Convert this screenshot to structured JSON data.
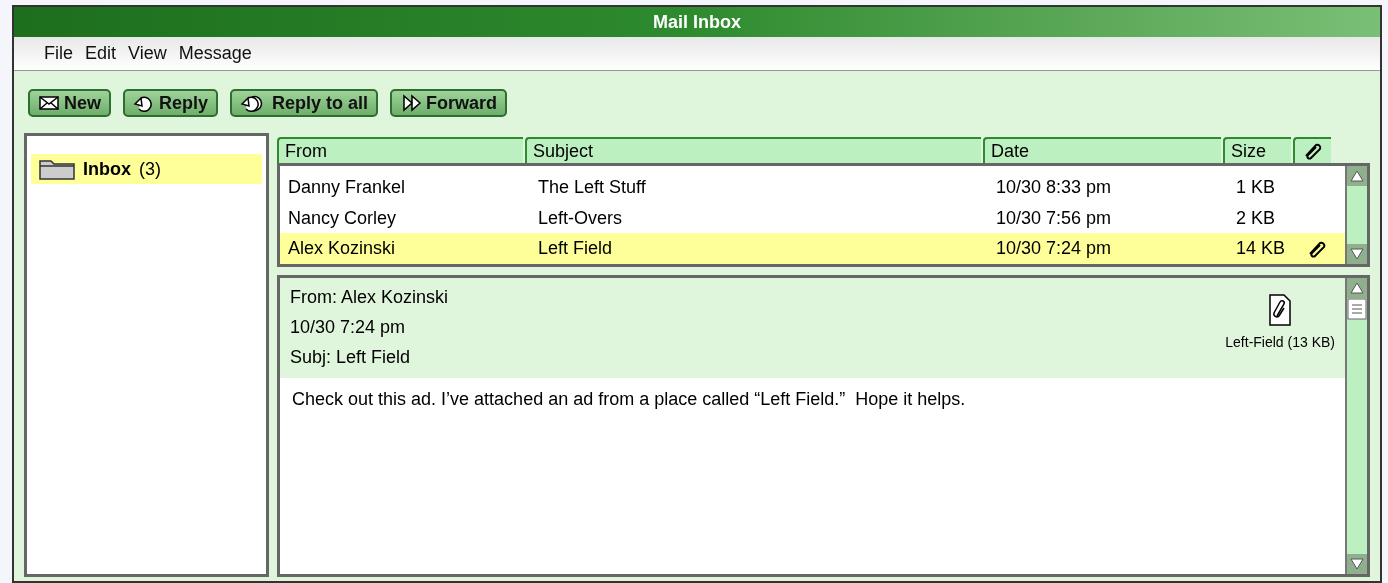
{
  "window": {
    "title": "Mail Inbox"
  },
  "menu": [
    "File",
    "Edit",
    "View",
    "Message"
  ],
  "toolbar": [
    {
      "label": "New",
      "kind": "new"
    },
    {
      "label": "Reply",
      "kind": "reply"
    },
    {
      "label": "Reply to all",
      "kind": "replyall"
    },
    {
      "label": "Forward",
      "kind": "forward"
    }
  ],
  "folders": [
    {
      "name": "Inbox",
      "count": "(3)",
      "selected": true
    }
  ],
  "table": {
    "columns": [
      "From",
      "Subject",
      "Date",
      "Size"
    ],
    "rows": [
      {
        "from": "Danny Frankel",
        "subject": "The Left Stuff",
        "date": "10/30 8:33 pm",
        "size": "1 KB",
        "attachment": false,
        "selected": false
      },
      {
        "from": "Nancy Corley",
        "subject": "Left-Overs",
        "date": "10/30 7:56 pm",
        "size": "2 KB",
        "attachment": false,
        "selected": false
      },
      {
        "from": "Alex Kozinski",
        "subject": "Left Field",
        "date": "10/30 7:24 pm",
        "size": "14 KB",
        "attachment": true,
        "selected": true
      }
    ]
  },
  "preview": {
    "from": "From: Alex Kozinski",
    "date": "10/30 7:24 pm",
    "subject": "Subj: Left Field",
    "attachment": "Left-Field (13 KB)",
    "body": "Check out this ad. I’ve attached an ad from a place called “Left Field.”  Hope it helps."
  }
}
